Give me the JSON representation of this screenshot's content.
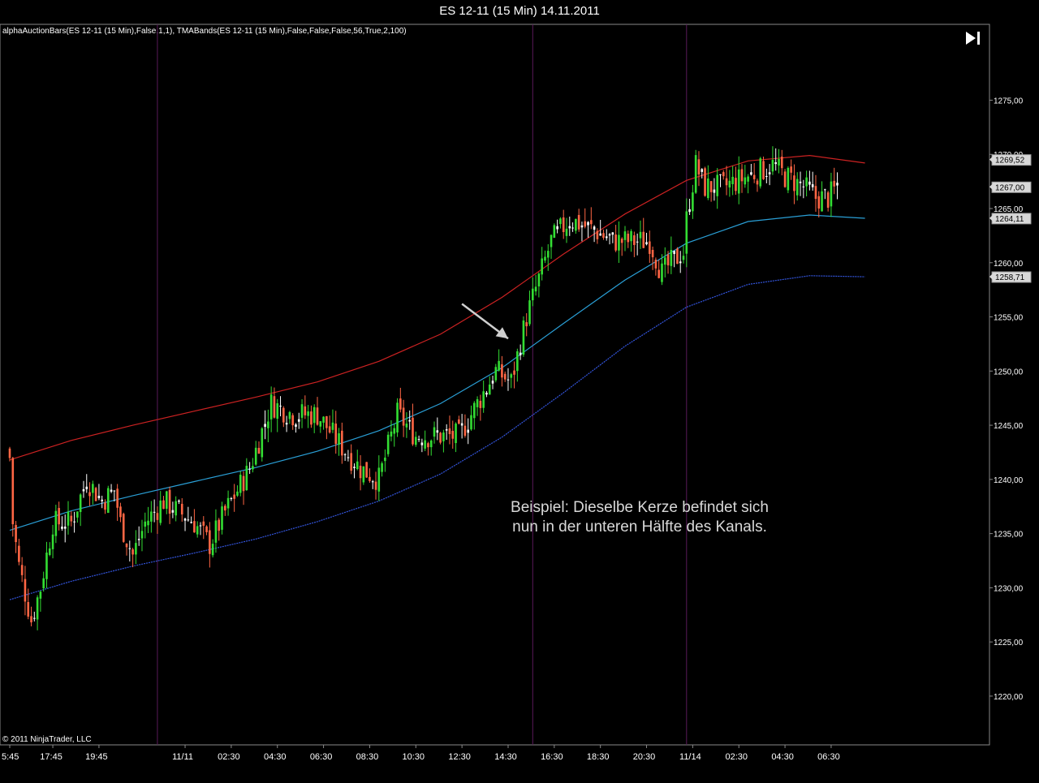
{
  "window": {
    "title": "ES 12-11 (15 Min)  14.11.2011"
  },
  "indicator_label": "alphaAuctionBars(ES 12-11 (15 Min),False,1,1), TMABands(ES 12-11 (15 Min),False,False,False,56,True,2,100)",
  "annotation": {
    "line1": "Beispiel: Dieselbe Kerze befindet sich",
    "line2": "nun in der unteren Hälfte des Kanals."
  },
  "copyright": "© 2011 NinjaTrader, LLC",
  "icons": {
    "goto_end": "skip-to-end-icon",
    "arrow": "annotation-arrow-icon"
  },
  "colors": {
    "up_candle": "#33dd33",
    "down_candle": "#ff6644",
    "doji": "#ffffff",
    "upper_band": "#cc2222",
    "middle_band": "#2a9fd6",
    "lower_band": "#3355dd",
    "session_line": "#5a1a5a",
    "background": "#000000"
  },
  "chart_data": {
    "type": "candlestick",
    "instrument": "ES 12-11",
    "period": "15 Min",
    "ylim": [
      1215.5,
      1282
    ],
    "y_ticks": [
      "1220,00",
      "1225,00",
      "1230,00",
      "1235,00",
      "1240,00",
      "1245,00",
      "1250,00",
      "1255,00",
      "1260,00",
      "1265,00",
      "1270,00",
      "1275,00"
    ],
    "x_ticks": [
      "5:45",
      "17:45",
      "19:45",
      "11/11",
      "02:30",
      "04:30",
      "06:30",
      "08:30",
      "10:30",
      "12:30",
      "14:30",
      "16:30",
      "18:30",
      "20:30",
      "11/14",
      "02:30",
      "04:30",
      "06:30"
    ],
    "session_breaks": [
      "11/11",
      "15:30",
      "11/14"
    ],
    "price_markers": [
      {
        "label": "1269,52",
        "value": 1269.52
      },
      {
        "label": "1267,00",
        "value": 1267.0
      },
      {
        "label": "1264,11",
        "value": 1264.11
      },
      {
        "label": "1258,71",
        "value": 1258.71
      }
    ],
    "series": [
      {
        "name": "TMA upper band",
        "values": [
          [
            0,
            1241.8
          ],
          [
            20,
            1243.6
          ],
          [
            40,
            1245.0
          ],
          [
            60,
            1246.3
          ],
          [
            80,
            1247.6
          ],
          [
            100,
            1249.0
          ],
          [
            120,
            1250.9
          ],
          [
            140,
            1253.4
          ],
          [
            160,
            1256.8
          ],
          [
            180,
            1260.8
          ],
          [
            200,
            1264.5
          ],
          [
            220,
            1267.6
          ],
          [
            240,
            1269.4
          ],
          [
            260,
            1269.9
          ],
          [
            278,
            1269.2
          ]
        ]
      },
      {
        "name": "TMA middle",
        "values": [
          [
            0,
            1235.3
          ],
          [
            20,
            1237.1
          ],
          [
            40,
            1238.5
          ],
          [
            60,
            1239.8
          ],
          [
            80,
            1241.1
          ],
          [
            100,
            1242.6
          ],
          [
            120,
            1244.5
          ],
          [
            140,
            1247.0
          ],
          [
            160,
            1250.3
          ],
          [
            180,
            1254.4
          ],
          [
            200,
            1258.4
          ],
          [
            220,
            1261.8
          ],
          [
            240,
            1263.8
          ],
          [
            260,
            1264.4
          ],
          [
            278,
            1264.1
          ]
        ]
      },
      {
        "name": "TMA lower band",
        "values": [
          [
            0,
            1228.9
          ],
          [
            20,
            1230.6
          ],
          [
            40,
            1232.0
          ],
          [
            60,
            1233.2
          ],
          [
            80,
            1234.5
          ],
          [
            100,
            1236.1
          ],
          [
            120,
            1238.0
          ],
          [
            140,
            1240.5
          ],
          [
            160,
            1243.9
          ],
          [
            180,
            1248.0
          ],
          [
            200,
            1252.3
          ],
          [
            220,
            1255.9
          ],
          [
            240,
            1258.0
          ],
          [
            260,
            1258.8
          ],
          [
            278,
            1258.7
          ]
        ]
      }
    ],
    "arrow": {
      "from": {
        "bar": 147,
        "price": 1256.2
      },
      "to": {
        "bar": 162,
        "price": 1253.0
      }
    }
  }
}
